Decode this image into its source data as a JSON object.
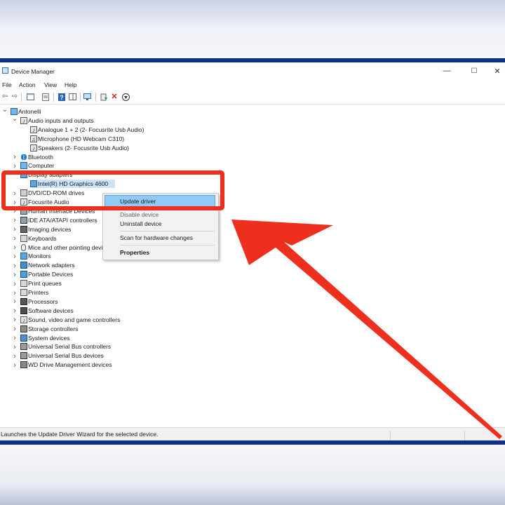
{
  "window": {
    "title": "Device Manager",
    "minimize_glyph": "—",
    "maximize_glyph": "☐",
    "close_glyph": "✕"
  },
  "menu": [
    "File",
    "Action",
    "View",
    "Help"
  ],
  "toolbar_icons": [
    "back-arrow-icon",
    "forward-arrow-icon",
    "show-hide-console-tree-icon",
    "properties-icon",
    "help-icon",
    "action-pane-icon",
    "scan-hardware-icon",
    "update-driver-icon",
    "uninstall-device-icon",
    "disable-device-icon"
  ],
  "tree": {
    "root": "Antonelli",
    "categories": [
      {
        "label": "Audio inputs and outputs",
        "expanded": true,
        "icon": "speaker-icon",
        "children": [
          {
            "label": "Analogue 1 + 2 (2- Focusrite Usb Audio)",
            "icon": "speaker-icon"
          },
          {
            "label": "Microphone (HD Webcam C310)",
            "icon": "microphone-icon"
          },
          {
            "label": "Speakers (2- Focusrite Usb Audio)",
            "icon": "speaker-icon"
          }
        ]
      },
      {
        "label": "Bluetooth",
        "icon": "bluetooth-icon"
      },
      {
        "label": "Computer",
        "icon": "computer-icon"
      },
      {
        "label": "Display adapters",
        "expanded": true,
        "icon": "monitor-icon",
        "children": [
          {
            "label": "Intel(R) HD Graphics 4600",
            "icon": "monitor-icon",
            "selected": true
          }
        ]
      },
      {
        "label": "DVD/CD-ROM drives",
        "icon": "disc-drive-icon"
      },
      {
        "label": "Focusrite Audio",
        "icon": "speaker-icon"
      },
      {
        "label": "Human Interface Devices",
        "icon": "hid-icon"
      },
      {
        "label": "IDE ATA/ATAPI controllers",
        "icon": "ide-controller-icon"
      },
      {
        "label": "Imaging devices",
        "icon": "camera-icon"
      },
      {
        "label": "Keyboards",
        "icon": "keyboard-icon"
      },
      {
        "label": "Mice and other pointing devices",
        "icon": "mouse-icon"
      },
      {
        "label": "Monitors",
        "icon": "monitor-icon"
      },
      {
        "label": "Network adapters",
        "icon": "network-icon"
      },
      {
        "label": "Portable Devices",
        "icon": "portable-device-icon"
      },
      {
        "label": "Print queues",
        "icon": "printer-icon"
      },
      {
        "label": "Printers",
        "icon": "printer-icon"
      },
      {
        "label": "Processors",
        "icon": "processor-icon"
      },
      {
        "label": "Software devices",
        "icon": "software-device-icon"
      },
      {
        "label": "Sound, video and game controllers",
        "icon": "speaker-icon"
      },
      {
        "label": "Storage controllers",
        "icon": "storage-icon"
      },
      {
        "label": "System devices",
        "icon": "system-device-icon"
      },
      {
        "label": "Universal Serial Bus controllers",
        "icon": "usb-icon"
      },
      {
        "label": "Universal Serial Bus devices",
        "icon": "usb-icon"
      },
      {
        "label": "WD Drive Management devices",
        "icon": "drive-management-icon"
      }
    ]
  },
  "context_menu": {
    "items": [
      {
        "label": "Update driver",
        "highlighted": true
      },
      {
        "label": "Disable device"
      },
      {
        "label": "Uninstall device"
      },
      {
        "label": "Scan for hardware changes"
      },
      {
        "label": "Properties",
        "bold": true
      }
    ]
  },
  "status_bar": "Launches the Update Driver Wizard for the selected device.",
  "colors": {
    "highlight_box": "#ee2f1d",
    "arrow": "#ee2f1d",
    "selection": "#cce4f7",
    "menu_highlight": "#91c9f7",
    "frame": "#0f2f8a"
  }
}
